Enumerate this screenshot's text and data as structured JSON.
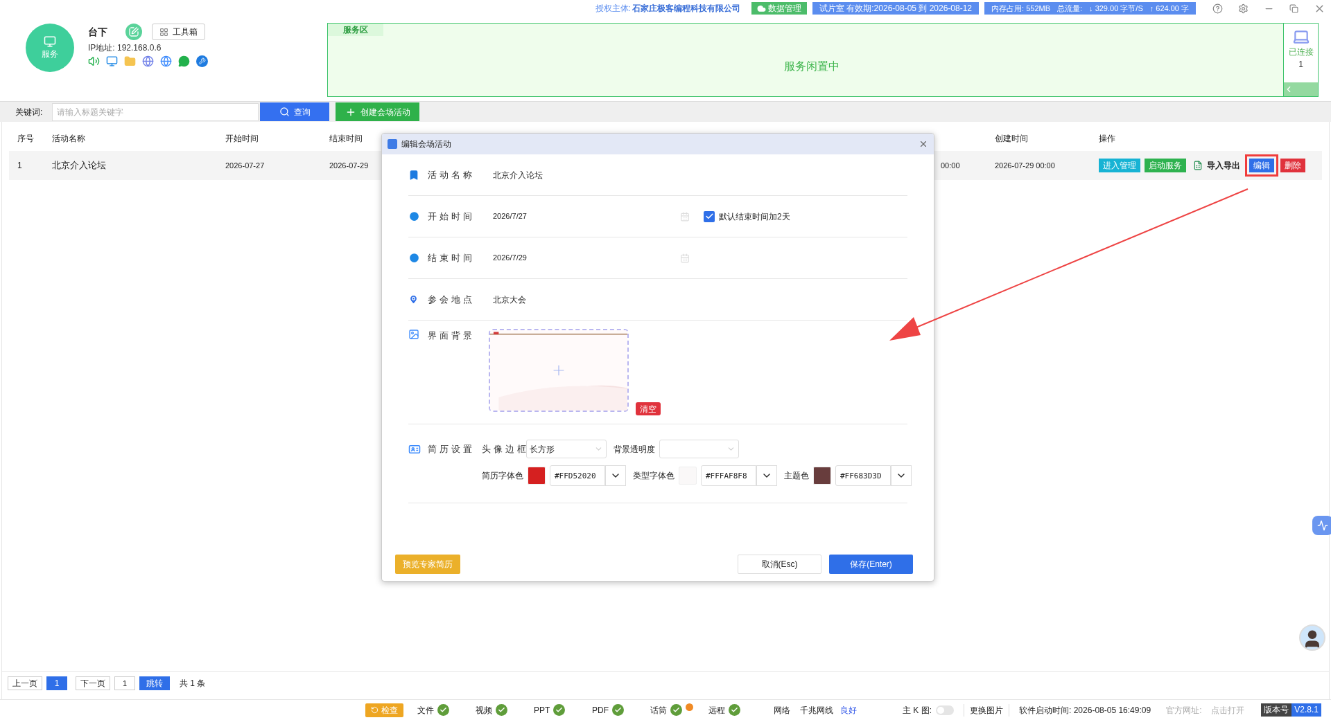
{
  "header": {
    "license_label": "授权主体:",
    "license_value": "石家庄极客编程科技有限公司",
    "data_button": "数据管理",
    "trial_badge": "试片室 有效期:2026-08-05 到 2026-08-12",
    "memory_badge": "内存占用:  552MB",
    "traffic_label": "总流量:",
    "down_rate": "↓ 329.00 字节/S",
    "up_rate": "↑ 624.00 字"
  },
  "profile": {
    "logo_label": "服务",
    "name": "台下",
    "toolbox_button": "工具箱",
    "ip": "IP地址: 192.168.0.6"
  },
  "service_area": {
    "tag": "服务区",
    "status": "服务闲置中",
    "connected_label": "已连接",
    "connected_count": "1"
  },
  "search": {
    "label": "关键词:",
    "placeholder": "请输入标题关键字",
    "query_button": "查询",
    "create_button": "创建会场活动"
  },
  "table": {
    "columns": [
      "序号",
      "活动名称",
      "开始时间",
      "结束时间",
      "创建时间",
      "操作"
    ],
    "rows": [
      {
        "index": "1",
        "name": "北京介入论坛",
        "start": "2026-07-27",
        "end": "2026-07-29",
        "column_5": "00:00",
        "created": "2026-07-29 00:00",
        "actions": [
          {
            "kind": "button",
            "label": "进入管理",
            "color": "#17b3d4",
            "highlighted": false
          },
          {
            "kind": "button",
            "label": "启动服务",
            "color": "#2eb24f",
            "highlighted": false
          },
          {
            "kind": "link",
            "label": "导入导出",
            "highlighted": false
          },
          {
            "kind": "button",
            "label": "编辑",
            "color": "#2f6fe8",
            "highlighted": true
          },
          {
            "kind": "button",
            "label": "删除",
            "color": "#e0323c",
            "highlighted": false
          }
        ]
      }
    ]
  },
  "dialog": {
    "title": "编辑会场活动",
    "name_field": {
      "label": "活动名称",
      "value": "北京介入论坛"
    },
    "start_field": {
      "label": "开始时间",
      "value": "2026/7/27",
      "checkbox": {
        "label": "默认结束时间加2天",
        "checked": true
      }
    },
    "end_field": {
      "label": "结束时间",
      "value": "2026/7/29"
    },
    "location_field": {
      "label": "参会地点",
      "value": "北京大会"
    },
    "background_field": {
      "label": "界面背景",
      "clear_button": "清空"
    },
    "resume_settings": {
      "label": "简历设置",
      "avatar_frame": {
        "label": "头像边框",
        "value": "长方形"
      },
      "opacity": {
        "label": "背景透明度"
      },
      "colors": [
        {
          "label": "简历字体色",
          "value": "#FFD52020",
          "color": "#d52020"
        },
        {
          "label": "类型字体色",
          "value": "#FFFAF8F8",
          "color": "#faf8f8"
        },
        {
          "label": "主题色",
          "value": "#FF683D3D",
          "color": "#683d3d"
        }
      ]
    },
    "preview_button": "预览专家简历",
    "cancel_button": "取消(Esc)",
    "save_button": "保存(Enter)"
  },
  "pagination": {
    "prev": "上一页",
    "pages": [
      {
        "label": "1",
        "selected": true
      }
    ],
    "next": "下一页",
    "jump_value": "1",
    "jump_button": "跳转",
    "total": "共 1 条"
  },
  "status_bar": {
    "check_button": "检查",
    "checks": [
      {
        "label": "文件",
        "ok": true,
        "warning": false
      },
      {
        "label": "视频",
        "ok": true,
        "warning": false
      },
      {
        "label": "PPT",
        "ok": true,
        "warning": false
      },
      {
        "label": "PDF",
        "ok": true,
        "warning": false
      },
      {
        "label": "话筒",
        "ok": true,
        "warning": true
      },
      {
        "label": "远程",
        "ok": true,
        "warning": false
      }
    ],
    "network_label": "网络",
    "network_type": "千兆网线",
    "network_quality": "良好",
    "kmap_label": "主 K 图:",
    "kmap_on": false,
    "change_image": "更换图片",
    "start_time": "软件启动时间: 2026-08-05 16:49:09",
    "site_label": "官方网址:",
    "site_link": "点击打开",
    "version_label": "版本号",
    "version": "V2.8.1"
  }
}
